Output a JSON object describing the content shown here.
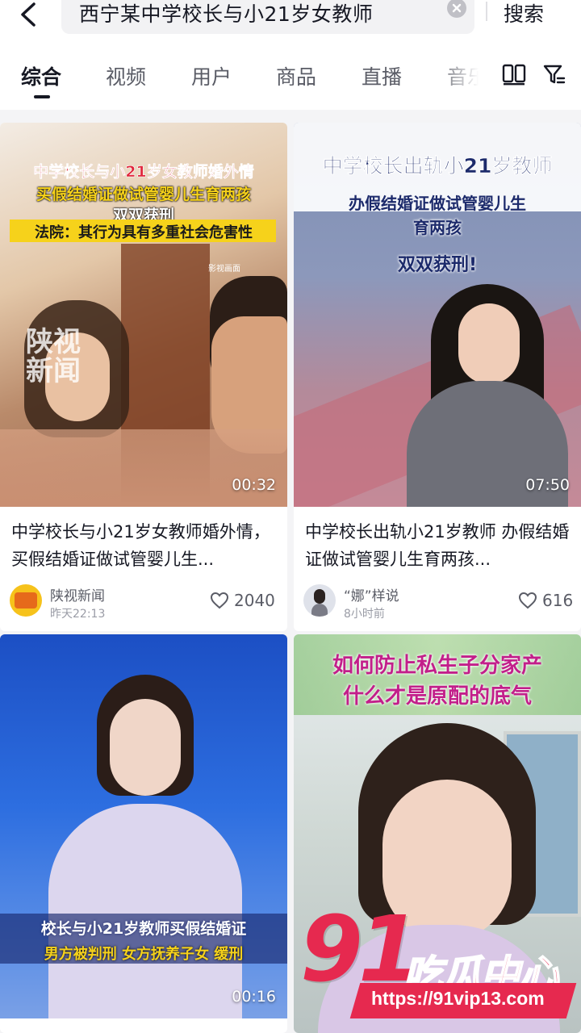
{
  "header": {
    "query": "西宁某中学校长与小21岁女教师",
    "search_label": "搜索"
  },
  "tabs": [
    {
      "label": "综合",
      "active": true
    },
    {
      "label": "视频",
      "active": false
    },
    {
      "label": "用户",
      "active": false
    },
    {
      "label": "商品",
      "active": false
    },
    {
      "label": "直播",
      "active": false
    },
    {
      "label": "音乐",
      "active": false
    }
  ],
  "cards": [
    {
      "overlay": [
        "中学校长与小21岁女教师婚外情",
        "买假结婚证做试管婴儿生育两孩",
        "双双获刑",
        "法院：其行为具有多重社会危害性"
      ],
      "source_mark": "影视画面",
      "logo": "陕视新闻",
      "duration": "00:32",
      "title": "中学校长与小21岁女教师婚外情，买假结婚证做试管婴儿生...",
      "author": "陕视新闻",
      "time": "昨天22:13",
      "likes": "2040"
    },
    {
      "overlay": [
        "中学校长出轨小21岁教师",
        "办假结婚证做试管婴儿生",
        "育两孩",
        "双双获刑!"
      ],
      "duration": "07:50",
      "title": "中学校长出轨小21岁教师 办假结婚证做试管婴儿生育两孩...",
      "author": "“娜”样说",
      "time": "8小时前",
      "likes": "616"
    },
    {
      "overlay": [
        "校长与小21岁教师买假结婚证",
        "男方被判刑 女方抚养子女 缓刑"
      ],
      "duration": "00:16"
    },
    {
      "overlay": [
        "如何防止私生子分家产",
        "什么才是原配的底气"
      ]
    }
  ],
  "watermark": {
    "number": "91",
    "text": "吃瓜中心",
    "url": "https://91vip13.com"
  },
  "colors": {
    "accent": "#e6294f",
    "overlay_red": "#e0243a",
    "overlay_yellow": "#f6d21b"
  }
}
